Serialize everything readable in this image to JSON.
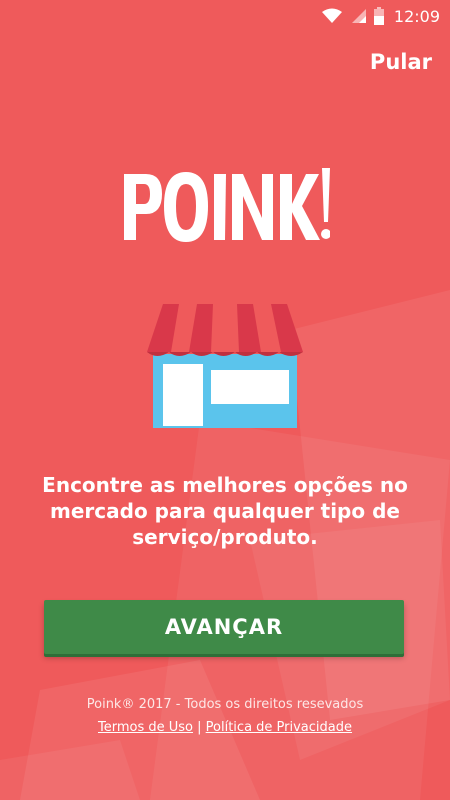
{
  "status_bar": {
    "time": "12:09",
    "icons": [
      "wifi-icon",
      "signal-icon",
      "battery-icon"
    ]
  },
  "header": {
    "skip_label": "Pular"
  },
  "logo": {
    "text": "POINK!"
  },
  "illustration": {
    "icon": "store-icon"
  },
  "main": {
    "tagline": "Encontre as melhores opções no mercado para qualquer tipo de serviço/produto.",
    "next_label": "AVANÇAR"
  },
  "footer": {
    "copyright": "Poink® 2017 - Todos os direitos resevados",
    "terms_label": "Termos de Uso",
    "separator": "|",
    "privacy_label": "Política de Privacidade"
  },
  "colors": {
    "background": "#ef5a5b",
    "button": "#3f8a48",
    "awning_red": "#d9384a",
    "store_blue": "#5bc4ec"
  }
}
